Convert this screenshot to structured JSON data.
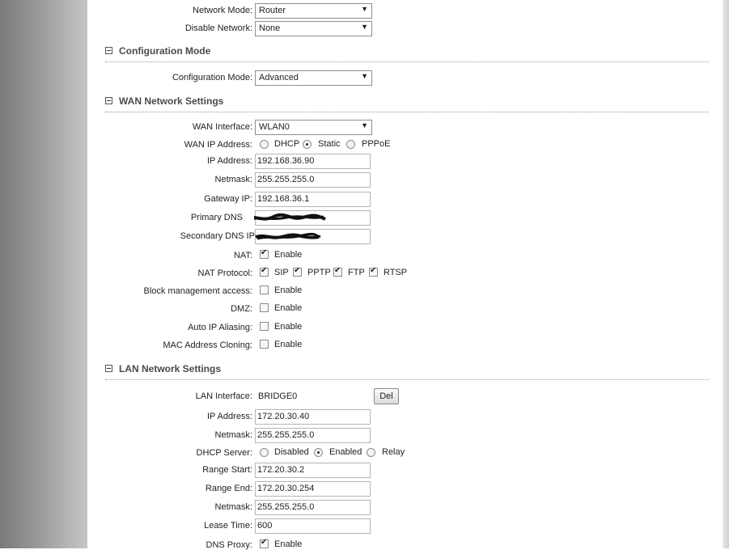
{
  "top": {
    "network_mode": {
      "label": "Network Mode:",
      "value": "Router"
    },
    "disable_network": {
      "label": "Disable Network:",
      "value": "None"
    }
  },
  "config_section": {
    "title": "Configuration Mode",
    "mode": {
      "label": "Configuration Mode:",
      "value": "Advanced"
    }
  },
  "wan": {
    "title": "WAN Network Settings",
    "interface": {
      "label": "WAN Interface:",
      "value": "WLAN0"
    },
    "ip_mode": {
      "label": "WAN IP Address:",
      "options": [
        "DHCP",
        "Static",
        "PPPoE"
      ],
      "selected": "Static"
    },
    "ip": {
      "label": "IP Address:",
      "value": "192.168.36.90"
    },
    "netmask": {
      "label": "Netmask:",
      "value": "255.255.255.0"
    },
    "gateway": {
      "label": "Gateway IP:",
      "value": "192.168.36.1"
    },
    "primary_dns": {
      "label": "Primary DNS"
    },
    "secondary_dns": {
      "label": "Secondary DNS IP:"
    },
    "nat": {
      "label": "NAT:",
      "enable": "Enable",
      "checked": true
    },
    "nat_protocol": {
      "label": "NAT Protocol:",
      "items": [
        {
          "name": "SIP",
          "checked": true
        },
        {
          "name": "PPTP",
          "checked": true
        },
        {
          "name": "FTP",
          "checked": true
        },
        {
          "name": "RTSP",
          "checked": true
        }
      ]
    },
    "block_mgmt": {
      "label": "Block management access:",
      "enable": "Enable",
      "checked": false
    },
    "dmz": {
      "label": "DMZ:",
      "enable": "Enable",
      "checked": false
    },
    "auto_ip": {
      "label": "Auto IP Aliasing:",
      "enable": "Enable",
      "checked": false
    },
    "mac_clone": {
      "label": "MAC Address Cloning:",
      "enable": "Enable",
      "checked": false
    }
  },
  "lan": {
    "title": "LAN Network Settings",
    "interface": {
      "label": "LAN Interface:",
      "value": "BRIDGE0",
      "del_label": "Del"
    },
    "ip": {
      "label": "IP Address:",
      "value": "172.20.30.40"
    },
    "netmask": {
      "label": "Netmask:",
      "value": "255.255.255.0"
    },
    "dhcp_server": {
      "label": "DHCP Server:",
      "options": [
        "Disabled",
        "Enabled",
        "Relay"
      ],
      "selected": "Enabled"
    },
    "range_start": {
      "label": "Range Start:",
      "value": "172.20.30.2"
    },
    "range_end": {
      "label": "Range End:",
      "value": "172.20.30.254"
    },
    "netmask2": {
      "label": "Netmask:",
      "value": "255.255.255.0"
    },
    "lease_time": {
      "label": "Lease Time:",
      "value": "600"
    },
    "dns_proxy": {
      "label": "DNS Proxy:",
      "enable": "Enable",
      "checked": true
    }
  }
}
